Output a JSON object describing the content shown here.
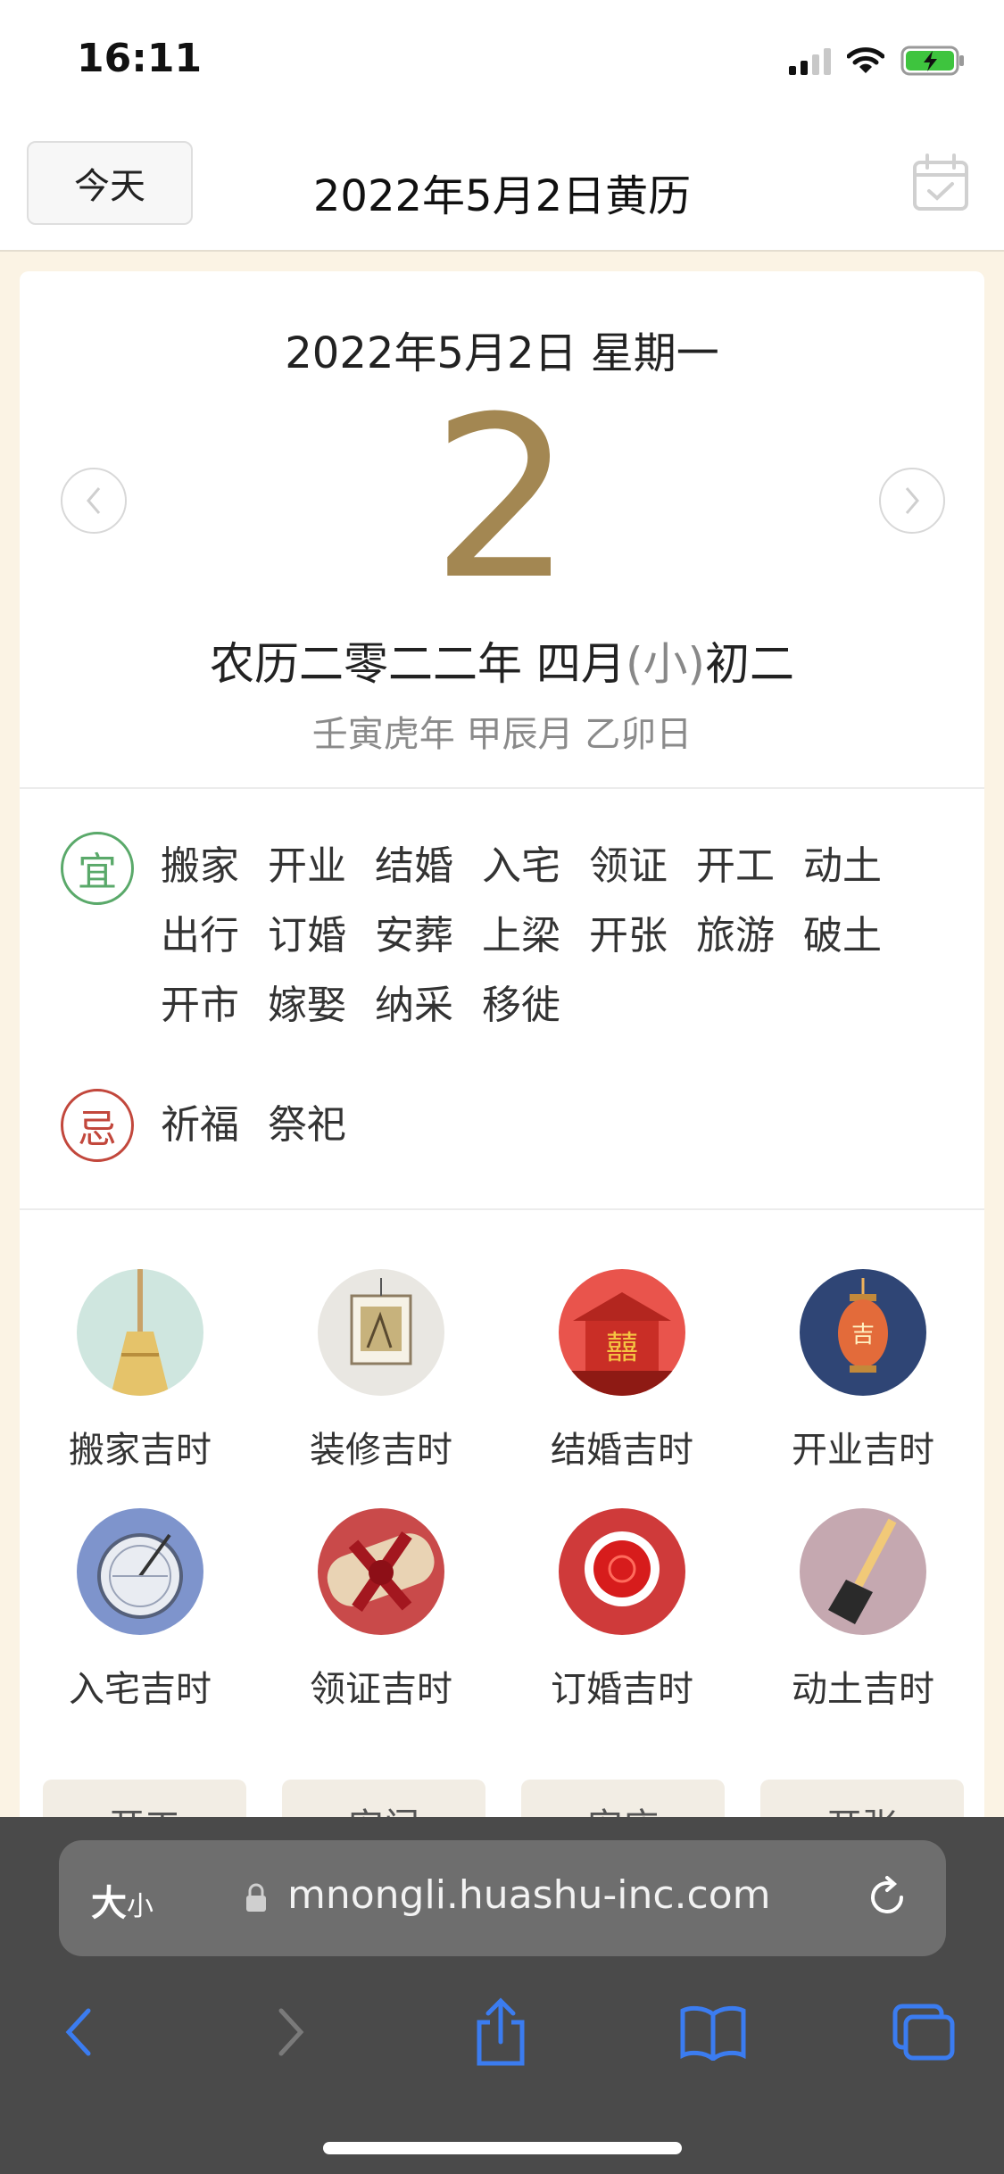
{
  "status_bar": {
    "time": "16:11"
  },
  "header": {
    "today_label": "今天",
    "title": "2022年5月2日黄历"
  },
  "day": {
    "date_line": "2022年5月2日 星期一",
    "big_number": "2",
    "lunar_prefix": "农历二零二二年 四月",
    "lunar_small": "(小)",
    "lunar_day": "初二",
    "ganzhi": "壬寅虎年 甲辰月 乙卯日"
  },
  "yi": {
    "badge": "宜",
    "items": [
      "搬家",
      "开业",
      "结婚",
      "入宅",
      "领证",
      "开工",
      "动土",
      "出行",
      "订婚",
      "安葬",
      "上梁",
      "开张",
      "旅游",
      "破土",
      "开市",
      "嫁娶",
      "纳采",
      "移徙"
    ]
  },
  "ji": {
    "badge": "忌",
    "items": [
      "祈福",
      "祭祀"
    ]
  },
  "icons": [
    {
      "label": "搬家吉时",
      "icon": "broom-icon"
    },
    {
      "label": "装修吉时",
      "icon": "painting-icon"
    },
    {
      "label": "结婚吉时",
      "icon": "wedding-gate-icon"
    },
    {
      "label": "开业吉时",
      "icon": "lantern-icon"
    },
    {
      "label": "入宅吉时",
      "icon": "compass-icon"
    },
    {
      "label": "领证吉时",
      "icon": "scroll-ribbon-icon"
    },
    {
      "label": "订婚吉时",
      "icon": "red-cup-icon"
    },
    {
      "label": "动土吉时",
      "icon": "shovel-icon"
    }
  ],
  "tags": [
    "开工",
    "安门",
    "安床",
    "开张"
  ],
  "browser": {
    "text_size_big": "大",
    "text_size_small": "小",
    "url": "mnongli.huashu-inc.com"
  },
  "colors": {
    "accent_gold": "#a38752",
    "yi_green": "#5aa96a",
    "ji_red": "#c2473c",
    "toolbar_blue": "#3b7cf0"
  }
}
